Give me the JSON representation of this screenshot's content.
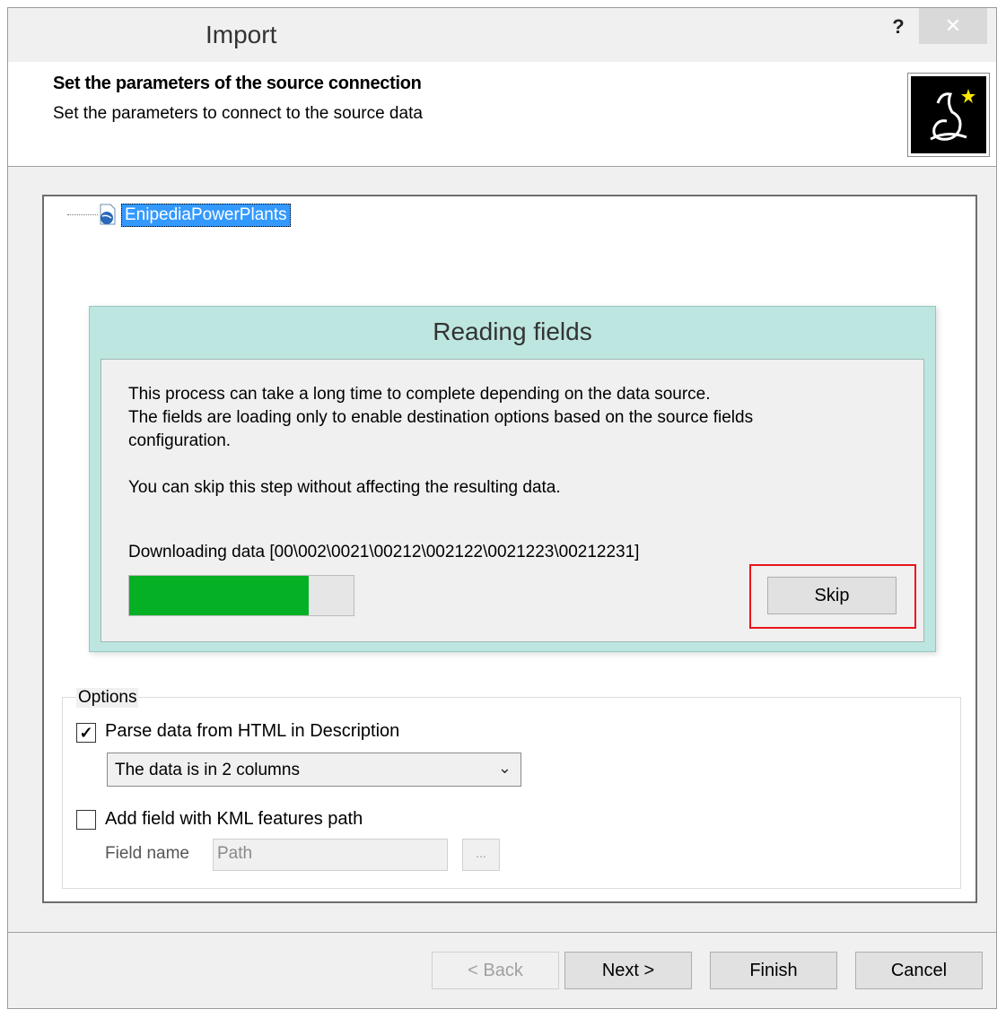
{
  "window": {
    "title": "Import",
    "help_label": "?",
    "close_label": "✕"
  },
  "header": {
    "title": "Set the parameters of the source connection",
    "subtitle": "Set the parameters to connect to the source data",
    "icon": "wizard-icon"
  },
  "tree": {
    "item_label": "EnipediaPowerPlants",
    "item_icon": "kml-layer-icon"
  },
  "progress_dialog": {
    "title": "Reading fields",
    "message_line1": "This process can take a long time to complete depending on the data source.",
    "message_line2": "The fields are loading only to enable destination options based on the source fields configuration.",
    "message_skip": "You can skip this step without affecting the resulting data.",
    "status": "Downloading  data [00\\002\\0021\\00212\\002122\\0021223\\00212231]",
    "progress_fraction": 0.8,
    "skip_label": "Skip",
    "colors": {
      "panel": "#bde6e0",
      "progress": "#06b025",
      "highlight": "#e8141b"
    }
  },
  "options": {
    "legend": "Options",
    "parse_html": {
      "label": "Parse data from HTML in Description",
      "checked": true
    },
    "columns_select": {
      "value": "The data is in 2 columns"
    },
    "add_path_field": {
      "label": "Add field with KML features path",
      "checked": false
    },
    "field_name": {
      "label": "Field name",
      "value": "Path",
      "browse_label": "..."
    }
  },
  "footer": {
    "back_label": "< Back",
    "next_label": "Next >",
    "finish_label": "Finish",
    "cancel_label": "Cancel"
  }
}
